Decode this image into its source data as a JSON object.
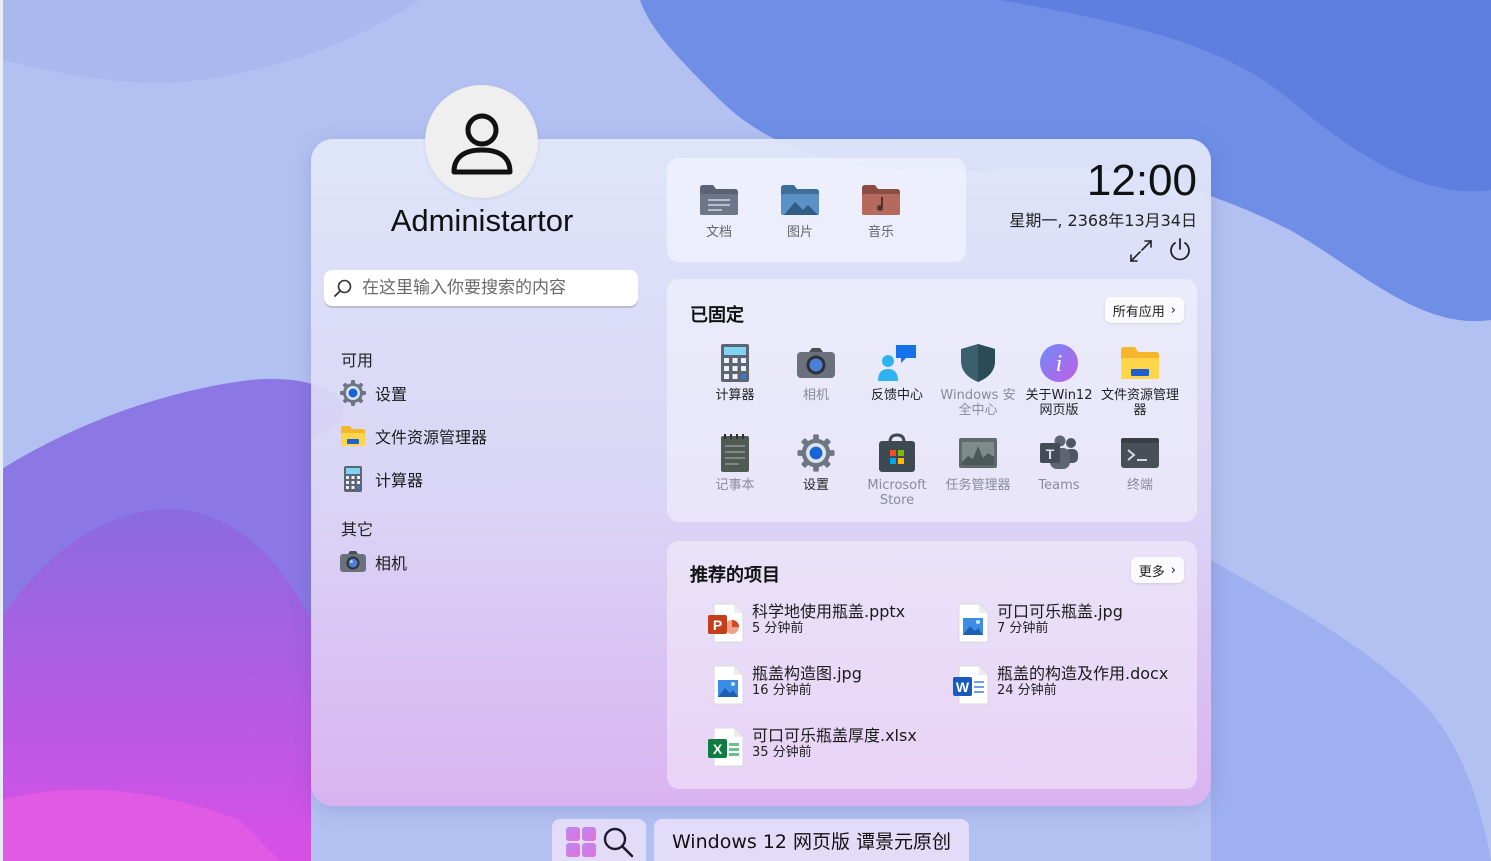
{
  "user": {
    "name": "Administartor"
  },
  "search": {
    "placeholder": "在这里输入你要搜索的内容"
  },
  "available": {
    "label": "可用",
    "items": [
      {
        "label": "设置",
        "icon": "gear-icon"
      },
      {
        "label": "文件资源管理器",
        "icon": "folder-icon"
      },
      {
        "label": "计算器",
        "icon": "calculator-icon"
      }
    ]
  },
  "others": {
    "label": "其它",
    "items": [
      {
        "label": "相机",
        "icon": "camera-icon"
      }
    ]
  },
  "folders": [
    {
      "label": "文档",
      "icon": "documents-folder-icon"
    },
    {
      "label": "图片",
      "icon": "pictures-folder-icon"
    },
    {
      "label": "音乐",
      "icon": "music-folder-icon"
    }
  ],
  "clock": {
    "time": "12:00",
    "date": "星期一, 2368年13月34日"
  },
  "pinned": {
    "title": "已固定",
    "all_apps": "所有应用",
    "apps": [
      {
        "label": "计算器",
        "icon": "calculator-icon"
      },
      {
        "label": "相机",
        "icon": "camera-icon"
      },
      {
        "label": "反馈中心",
        "icon": "feedback-hub-icon"
      },
      {
        "label": "Windows 安全中心",
        "icon": "shield-icon"
      },
      {
        "label": "关于Win12网页版",
        "icon": "info-icon"
      },
      {
        "label": "文件资源管理器",
        "icon": "folder-icon"
      },
      {
        "label": "记事本",
        "icon": "notepad-icon"
      },
      {
        "label": "设置",
        "icon": "gear-icon"
      },
      {
        "label": "Microsoft Store",
        "icon": "store-icon"
      },
      {
        "label": "任务管理器",
        "icon": "task-manager-icon"
      },
      {
        "label": "Teams",
        "icon": "teams-icon"
      },
      {
        "label": "终端",
        "icon": "terminal-icon"
      }
    ]
  },
  "recommended": {
    "title": "推荐的项目",
    "more": "更多",
    "items": [
      {
        "name": "科学地使用瓶盖.pptx",
        "time": "5 分钟前",
        "icon": "powerpoint-icon"
      },
      {
        "name": "可口可乐瓶盖.jpg",
        "time": "7 分钟前",
        "icon": "image-file-icon"
      },
      {
        "name": "瓶盖构造图.jpg",
        "time": "16 分钟前",
        "icon": "image-file-icon"
      },
      {
        "name": "瓶盖的构造及作用.docx",
        "time": "24 分钟前",
        "icon": "word-icon"
      },
      {
        "name": "可口可乐瓶盖厚度.xlsx",
        "time": "35 分钟前",
        "icon": "excel-icon"
      }
    ]
  },
  "taskbar": {
    "title": "Windows 12 网页版 谭景元原创"
  },
  "colors": {
    "accent": "#1a73e8",
    "wallpaper_blue": "#5b7ee0",
    "wallpaper_magenta": "#d84fe6",
    "menu_bg": "#e2e8fa"
  }
}
